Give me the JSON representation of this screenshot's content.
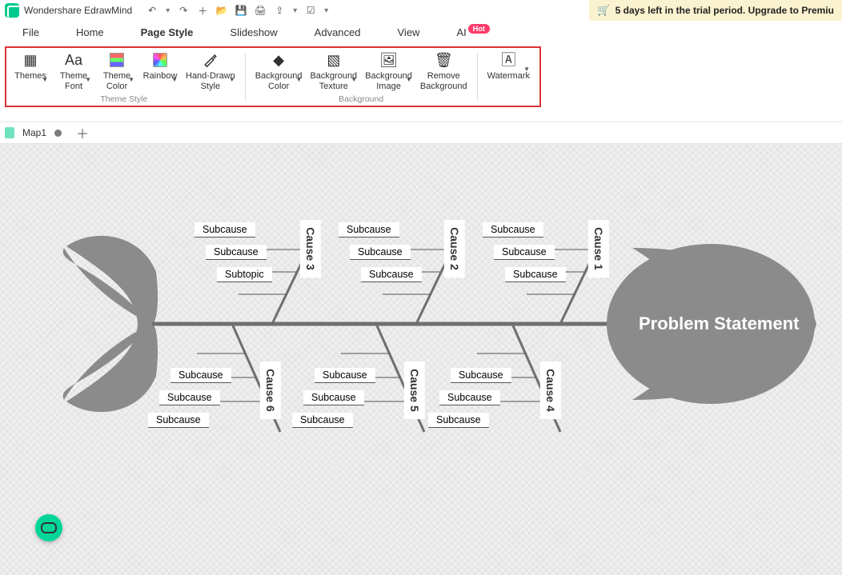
{
  "app": {
    "title": "Wondershare EdrawMind"
  },
  "trial": {
    "text": "5 days left in the trial period. Upgrade to Premiu"
  },
  "menu": {
    "file": "File",
    "home": "Home",
    "pagestyle": "Page Style",
    "slideshow": "Slideshow",
    "advanced": "Advanced",
    "view": "View",
    "ai": "AI",
    "hot": "Hot"
  },
  "ribbon": {
    "themes": "Themes",
    "themeFont": "Theme\nFont",
    "themeColor": "Theme\nColor",
    "rainbow": "Rainbow",
    "handdrawn": "Hand-Drawn\nStyle",
    "bgColor": "Background\nColor",
    "bgTexture": "Background\nTexture",
    "bgImage": "Background\nImage",
    "removeBg": "Remove\nBackground",
    "watermark": "Watermark",
    "group_theme": "Theme Style",
    "group_bg": "Background"
  },
  "tab": {
    "name": "Map1"
  },
  "fishbone": {
    "head": "Problem Statement",
    "causes": {
      "c1": "Cause 1",
      "c2": "Cause 2",
      "c3": "Cause 3",
      "c4": "Cause 4",
      "c5": "Cause 5",
      "c6": "Cause 6"
    },
    "top": {
      "c3": [
        "Subcause",
        "Subcause",
        "Subtopic"
      ],
      "c2": [
        "Subcause",
        "Subcause",
        "Subcause"
      ],
      "c1": [
        "Subcause",
        "Subcause",
        "Subcause"
      ]
    },
    "bottom": {
      "c6": [
        "Subcause",
        "Subcause",
        "Subcause"
      ],
      "c5": [
        "Subcause",
        "Subcause",
        "Subcause"
      ],
      "c4": [
        "Subcause",
        "Subcause",
        "Subcause"
      ]
    }
  }
}
